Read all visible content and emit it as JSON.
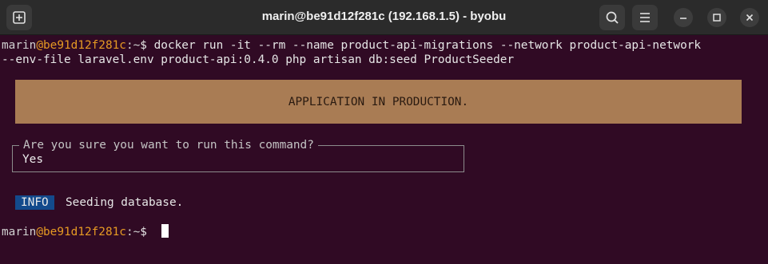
{
  "window": {
    "title": "marin@be91d12f281c (192.168.1.5) - byobu"
  },
  "titlebar": {
    "new_tab_icon": "new-tab-icon",
    "search_icon": "search-icon",
    "menu_icon": "hamburger-menu-icon",
    "minimize_icon": "minimize-icon",
    "maximize_icon": "maximize-icon",
    "close_icon": "close-icon"
  },
  "terminal": {
    "prompt": {
      "user": "marin",
      "at": "@",
      "host": "be91d12f281c",
      "path": ":~",
      "symbol": "$ "
    },
    "command_line_1": "docker run -it --rm --name product-api-migrations --network product-api-network",
    "command_line_2": "--env-file laravel.env product-api:0.4.0 php artisan db:seed ProductSeeder",
    "banner": "APPLICATION IN PRODUCTION.",
    "confirm_question": "Are you sure you want to run this command?",
    "confirm_answer": "Yes",
    "info_badge": "INFO",
    "info_message": "Seeding database."
  },
  "colors": {
    "background": "#300a24",
    "host": "#e69a23",
    "banner": "#a97c54",
    "info_badge": "#134a8c"
  }
}
